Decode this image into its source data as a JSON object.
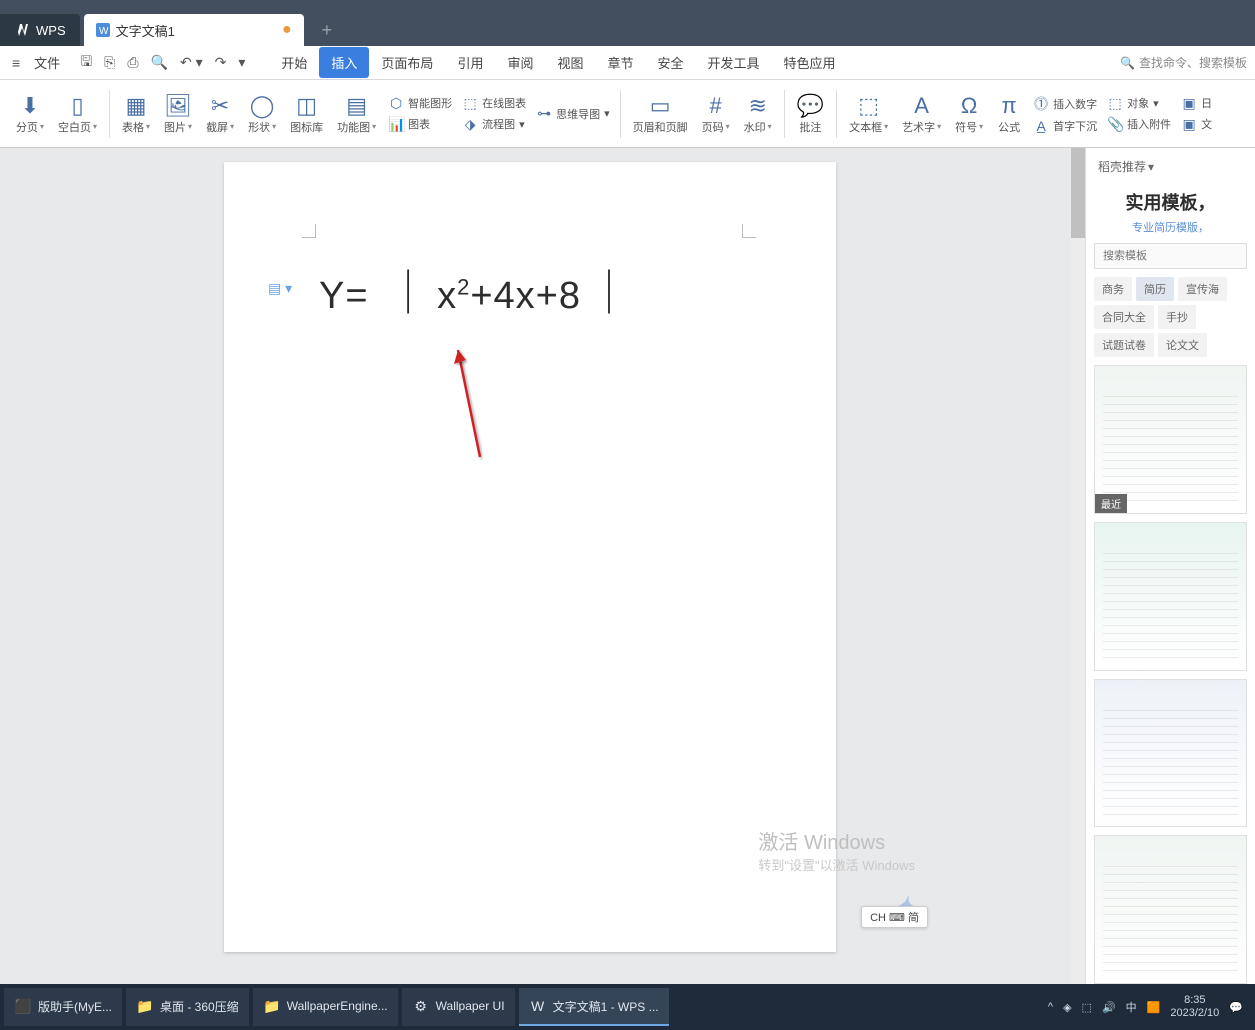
{
  "titlebar": {
    "app": "WPS",
    "doc_tab": "文字文稿1",
    "modified_dot": "●",
    "new_tab": "+"
  },
  "menubar": {
    "file": "文件",
    "menus": [
      "开始",
      "插入",
      "页面布局",
      "引用",
      "审阅",
      "视图",
      "章节",
      "安全",
      "开发工具",
      "特色应用"
    ],
    "active_index": 1,
    "search_placeholder": "查找命令、搜索模板"
  },
  "ribbon": {
    "items_big": [
      {
        "label": "分页",
        "dd": true
      },
      {
        "label": "空白页",
        "dd": true
      },
      {
        "label": "表格",
        "dd": true
      },
      {
        "label": "图片",
        "dd": true
      },
      {
        "label": "截屏",
        "dd": true
      },
      {
        "label": "形状",
        "dd": true
      },
      {
        "label": "图标库"
      },
      {
        "label": "功能图",
        "dd": true
      }
    ],
    "smart_col": [
      {
        "label": "智能图形"
      },
      {
        "label": "图表"
      }
    ],
    "online_col": [
      {
        "label": "在线图表"
      },
      {
        "label": "流程图",
        "dd": true
      }
    ],
    "mind_col": [
      {
        "label": "思维导图",
        "dd": true
      }
    ],
    "header_footer": "页眉和页脚",
    "page_num": {
      "label": "页码",
      "dd": true
    },
    "watermark": {
      "label": "水印",
      "dd": true
    },
    "comment": "批注",
    "textbox": {
      "label": "文本框",
      "dd": true
    },
    "wordart": {
      "label": "艺术字",
      "dd": true
    },
    "symbol": {
      "label": "符号",
      "dd": true
    },
    "formula": "公式",
    "right_col1": [
      {
        "label": "插入数字"
      },
      {
        "label": "首字下沉"
      }
    ],
    "right_col2": [
      {
        "label": "对象",
        "dd": true
      },
      {
        "label": "插入附件"
      }
    ],
    "right_col3": [
      {
        "label": "日"
      },
      {
        "label": "文"
      }
    ]
  },
  "document": {
    "equation_prefix": "Y= ",
    "abs_bar": "｜",
    "equation_x": "x",
    "equation_sup": "2",
    "equation_rest": "+4x+8"
  },
  "side_panel": {
    "header": "稻壳推荐",
    "title": "实用模板，",
    "subtitle": "专业简历模版，",
    "search_placeholder": "搜索模板",
    "cats": [
      "商务",
      "简历",
      "宣传海",
      "合同大全",
      "手抄",
      "试题试卷",
      "论文文"
    ],
    "active_cat_index": 1,
    "recent_badge": "最近"
  },
  "watermark": {
    "title": "激活 Windows",
    "sub": "转到\"设置\"以激活 Windows"
  },
  "ime": "CH ⌨ 简",
  "taskbar": {
    "items": [
      {
        "label": "版助手(MyE...",
        "icon": "⬛"
      },
      {
        "label": "桌面 - 360压缩",
        "icon": "📁"
      },
      {
        "label": "WallpaperEngine...",
        "icon": "📁"
      },
      {
        "label": "Wallpaper UI",
        "icon": "⚙"
      },
      {
        "label": "文字文稿1 - WPS ...",
        "icon": "W"
      }
    ],
    "active_index": 4,
    "tray": [
      "^",
      "◈",
      "⬚",
      "🔊",
      "中",
      "🟧"
    ],
    "time": "8:35",
    "date": "2023/2/10"
  }
}
